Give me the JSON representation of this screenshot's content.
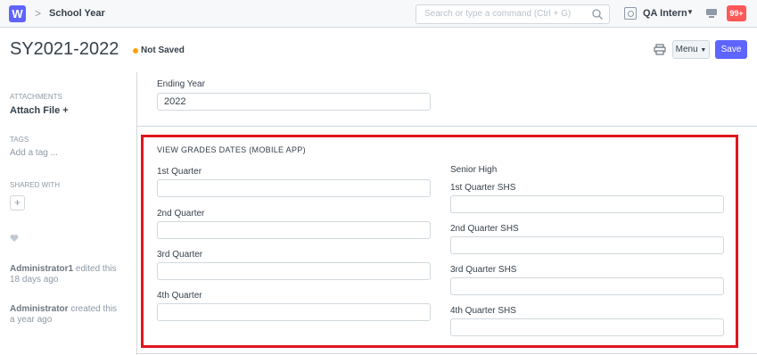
{
  "navbar": {
    "logo": "W",
    "breadcrumb": "School Year",
    "search_placeholder": "Search or type a command (Ctrl + G)",
    "user_name": "QA Intern",
    "notification_count": "99+"
  },
  "page": {
    "title": "SY2021-2022",
    "status": "Not Saved",
    "menu_label": "Menu",
    "save_label": "Save"
  },
  "sidebar": {
    "attachments_label": "ATTACHMENTS",
    "attach_file": "Attach File +",
    "tags_label": "TAGS",
    "add_tag": "Add a tag ...",
    "shared_with_label": "SHARED WITH",
    "share_add": "+",
    "timeline": [
      {
        "user": "Administrator1",
        "action": " edited this",
        "when": "18 days ago"
      },
      {
        "user": "Administrator",
        "action": " created this",
        "when": "a year ago"
      }
    ]
  },
  "form": {
    "ending_year_label": "Ending Year",
    "ending_year_value": "2022",
    "section_title": "VIEW GRADES DATES (MOBILE APP)",
    "left_fields": [
      "1st Quarter",
      "2nd Quarter",
      "3rd Quarter",
      "4th Quarter"
    ],
    "senior_high_heading": "Senior High",
    "right_fields": [
      "1st Quarter SHS",
      "2nd Quarter SHS",
      "3rd Quarter SHS",
      "4th Quarter SHS"
    ]
  },
  "colors": {
    "accent": "#5e64ff",
    "highlight_border": "#e0161f",
    "status_dot": "#ffa00a",
    "badge": "#ff5858"
  },
  "icons": [
    "search-icon",
    "user-avatar-icon",
    "notification-icon",
    "print-icon",
    "heart-icon",
    "caret-down-icon"
  ]
}
